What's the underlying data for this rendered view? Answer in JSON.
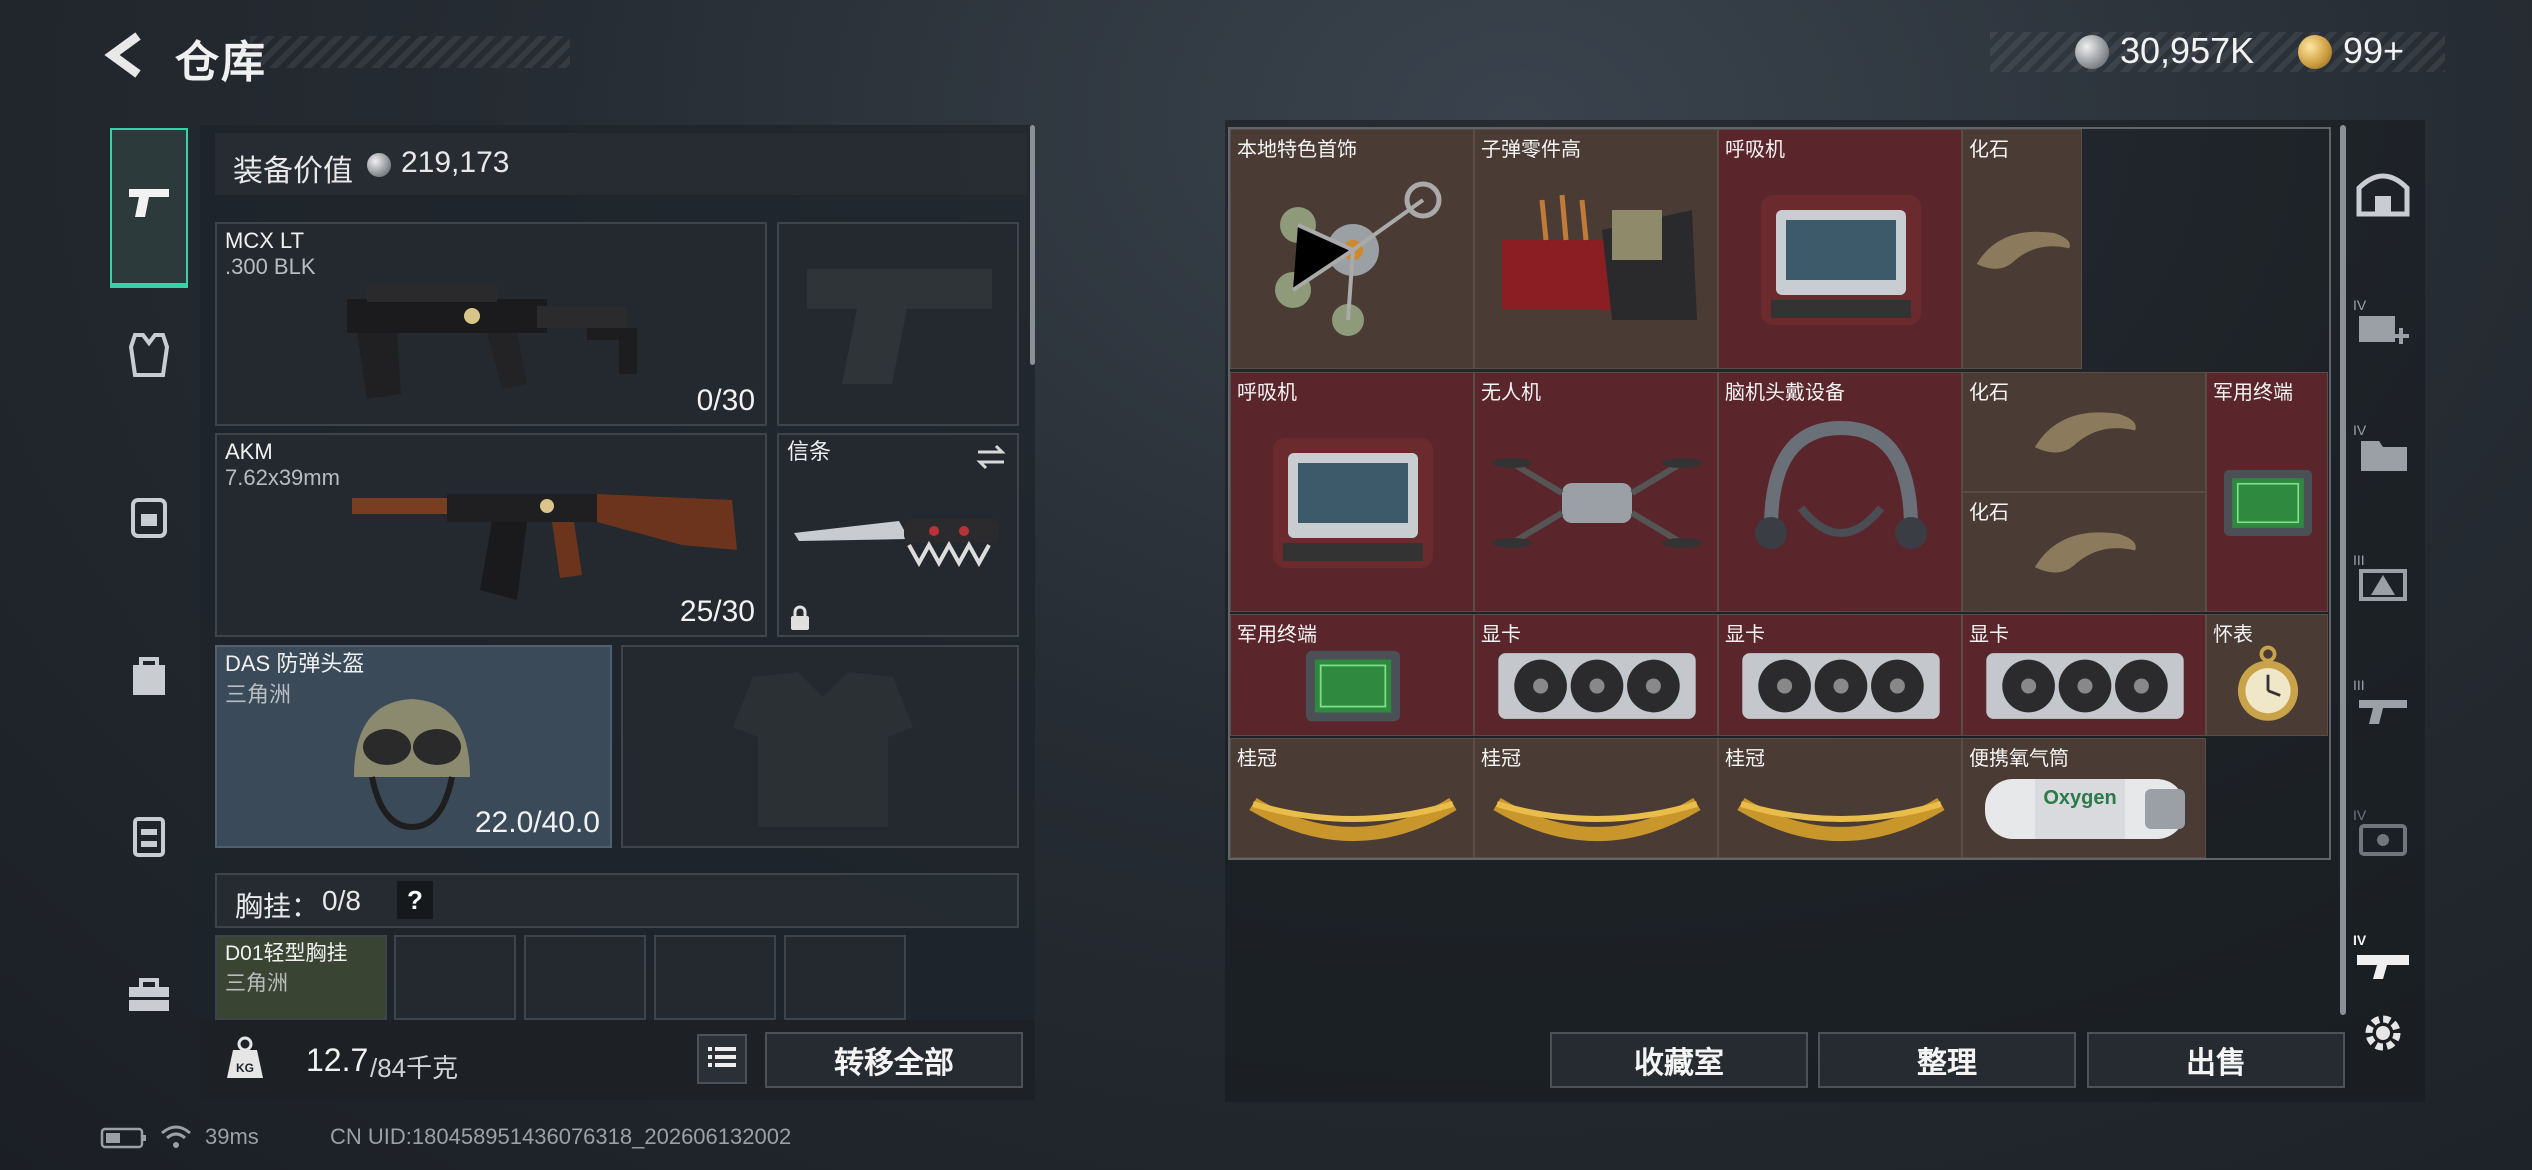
{
  "header": {
    "title": "仓库",
    "currency_silver": "30,957K",
    "currency_gold": "99+"
  },
  "sidebar": {
    "items": [
      "weapons",
      "armor",
      "backpack",
      "chest-rig",
      "case",
      "toolbox"
    ]
  },
  "equipment": {
    "value_label": "装备价值",
    "value": "219,173",
    "primary_weapon": {
      "name": "MCX LT",
      "ammo": ".300 BLK",
      "count": "0/30"
    },
    "secondary_weapon": {
      "name": "AKM",
      "ammo": "7.62x39mm",
      "count": "25/30"
    },
    "melee": {
      "name": "信条"
    },
    "helmet": {
      "name": "DAS 防弹头盔",
      "source": "三角洲",
      "durability": "22.0/40.0"
    },
    "chest_rig": {
      "label": "胸挂：",
      "count": "0/8",
      "help": "?"
    },
    "chest_rig_item": {
      "name": "D01轻型胸挂",
      "source": "三角洲"
    },
    "weight": {
      "current": "12.7",
      "max": "/84千克"
    },
    "transfer_all": "转移全部"
  },
  "stash": {
    "items": [
      {
        "name": "本地特色首饰",
        "bg": "gold",
        "icon": "jewelry-icon"
      },
      {
        "name": "子弹零件高",
        "bg": "gold",
        "icon": "ammo-parts-icon"
      },
      {
        "name": "呼吸机",
        "bg": "red",
        "icon": "ventilator-icon"
      },
      {
        "name": "化石",
        "bg": "gold",
        "icon": "fossil-icon"
      },
      {
        "name": "呼吸机",
        "bg": "red",
        "icon": "ventilator-icon"
      },
      {
        "name": "无人机",
        "bg": "red",
        "icon": "drone-icon"
      },
      {
        "name": "脑机头戴设备",
        "bg": "red",
        "icon": "headset-icon"
      },
      {
        "name": "化石",
        "bg": "gold",
        "icon": "fossil-icon"
      },
      {
        "name": "化石",
        "bg": "gold",
        "icon": "fossil-icon"
      },
      {
        "name": "军用终端",
        "bg": "red",
        "icon": "terminal-icon"
      },
      {
        "name": "军用终端",
        "bg": "red",
        "icon": "terminal-icon"
      },
      {
        "name": "显卡",
        "bg": "red",
        "icon": "gpu-icon"
      },
      {
        "name": "显卡",
        "bg": "red",
        "icon": "gpu-icon"
      },
      {
        "name": "显卡",
        "bg": "red",
        "icon": "gpu-icon"
      },
      {
        "name": "怀表",
        "bg": "gold",
        "icon": "pocket-watch-icon"
      },
      {
        "name": "桂冠",
        "bg": "gold",
        "icon": "laurel-icon"
      },
      {
        "name": "桂冠",
        "bg": "gold",
        "icon": "laurel-icon"
      },
      {
        "name": "桂冠",
        "bg": "gold",
        "icon": "laurel-icon"
      },
      {
        "name": "便携氧气筒",
        "bg": "gold",
        "icon": "oxygen-tank-icon"
      }
    ],
    "buttons": {
      "collection": "收藏室",
      "sort": "整理",
      "sell": "出售"
    }
  },
  "status_bar": {
    "ping": "39ms",
    "uid": "CN UID:180458951436076318_202606132002"
  },
  "colors": {
    "accent": "#38d2a8",
    "red_rarity": "#5a262b",
    "gold_rarity": "#4a3c34"
  }
}
